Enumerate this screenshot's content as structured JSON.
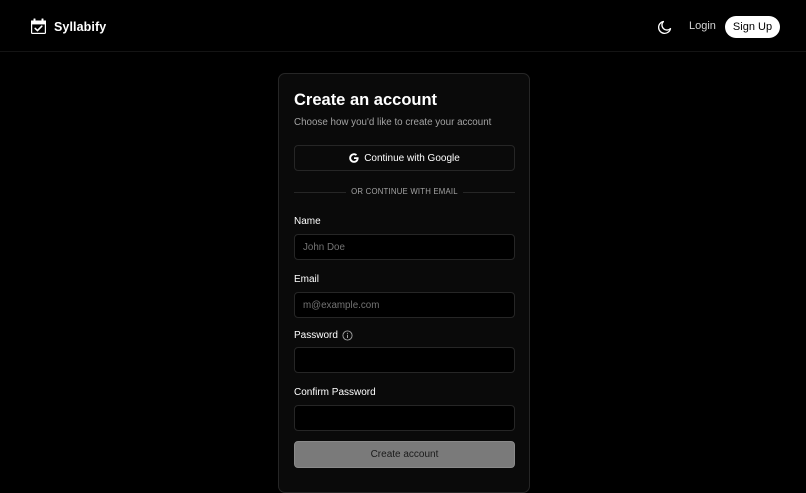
{
  "app": {
    "name": "Syllabify"
  },
  "nav": {
    "login_label": "Login",
    "signup_label": "Sign Up",
    "theme_icon": "moon-icon"
  },
  "card": {
    "title": "Create an account",
    "subtitle": "Choose how you'd like to create your account",
    "google_label": "Continue with Google",
    "divider_text": "OR CONTINUE WITH EMAIL",
    "fields": {
      "name": {
        "label": "Name",
        "placeholder": "John Doe",
        "value": ""
      },
      "email": {
        "label": "Email",
        "placeholder": "m@example.com",
        "value": ""
      },
      "password": {
        "label": "Password",
        "placeholder": "",
        "value": ""
      },
      "confirm_password": {
        "label": "Confirm Password",
        "placeholder": "",
        "value": ""
      }
    },
    "submit_label": "Create account"
  },
  "colors": {
    "background": "#000000",
    "card_background": "#0a0a0a",
    "border": "#262626",
    "muted_text": "#a3a3a3",
    "submit_disabled": "#7a7a7a"
  },
  "icons": [
    "calendar-check-icon",
    "moon-icon",
    "google-icon",
    "info-icon"
  ]
}
